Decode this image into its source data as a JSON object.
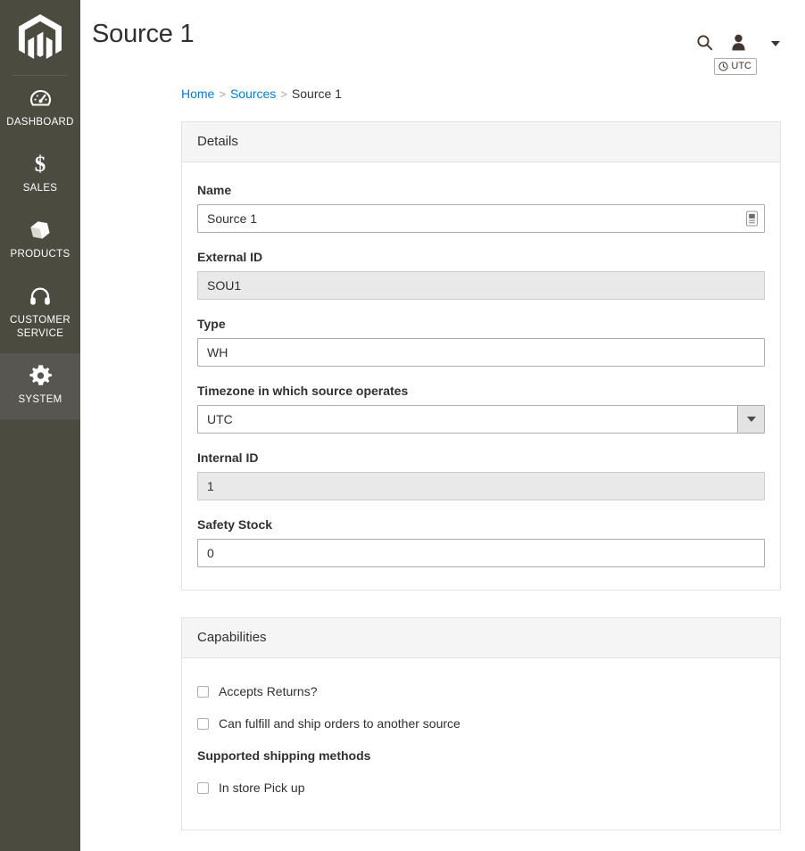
{
  "sidebar": {
    "logo": "magento-logo",
    "items": [
      {
        "label": "DASHBOARD",
        "icon": "dashboard-icon",
        "active": false
      },
      {
        "label": "SALES",
        "icon": "dollar-icon",
        "active": false
      },
      {
        "label": "PRODUCTS",
        "icon": "box-icon",
        "active": false
      },
      {
        "label": "CUSTOMER SERVICE",
        "label_line1": "CUSTOMER",
        "label_line2": "SERVICE",
        "icon": "headset-icon",
        "active": false
      },
      {
        "label": "SYSTEM",
        "icon": "gear-icon",
        "active": true
      }
    ]
  },
  "header": {
    "title": "Source 1",
    "search_icon": "search-icon",
    "user_icon": "user-icon",
    "user_name": "",
    "caret_icon": "chevron-down-icon",
    "timezone_badge": {
      "icon": "clock-icon",
      "label": "UTC"
    }
  },
  "breadcrumb": {
    "home": "Home",
    "sources": "Sources",
    "current": "Source 1",
    "separator": ">"
  },
  "details": {
    "panel_title": "Details",
    "fields": {
      "name": {
        "label": "Name",
        "value": "Source 1",
        "icon": "autofill-icon",
        "readonly": false
      },
      "external_id": {
        "label": "External ID",
        "value": "SOU1",
        "readonly": true
      },
      "type": {
        "label": "Type",
        "value": "WH",
        "readonly": false
      },
      "timezone": {
        "label": "Timezone in which source operates",
        "value": "UTC",
        "readonly": false
      },
      "internal_id": {
        "label": "Internal ID",
        "value": "1",
        "readonly": true
      },
      "safety_stock": {
        "label": "Safety Stock",
        "value": "0",
        "readonly": false
      }
    }
  },
  "capabilities": {
    "panel_title": "Capabilities",
    "checkboxes": [
      {
        "label": "Accepts Returns?",
        "checked": false
      },
      {
        "label": "Can fulfill and ship orders to another source",
        "checked": false
      }
    ],
    "shipping_methods_heading": "Supported shipping methods",
    "shipping_methods": [
      {
        "label": "In store Pick up",
        "checked": false
      }
    ]
  },
  "colors": {
    "sidebar_bg": "#4c4b40",
    "sidebar_active_bg": "#575651",
    "link": "#007bdb",
    "text": "#303030",
    "panel_head_bg": "#f5f5f5",
    "border": "#e3e3e3",
    "readonly_bg": "#e9e9e9"
  }
}
